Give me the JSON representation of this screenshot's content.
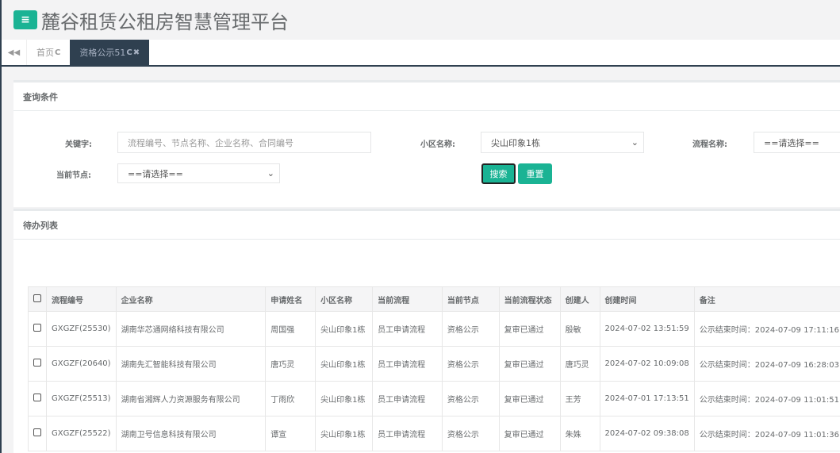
{
  "header": {
    "title": "麓谷租赁公租房智慧管理平台",
    "menu_icon": "≡"
  },
  "tabs": [
    {
      "label": "首页",
      "refresh": "C"
    },
    {
      "label": "资格公示51",
      "refresh": "C",
      "close": "✖"
    }
  ],
  "search_panel": {
    "title": "查询条件",
    "keyword_label": "关键字:",
    "keyword_placeholder": "流程编号、节点名称、企业名称、合同编号",
    "community_label": "小区名称:",
    "community_value": "尖山印象1栋",
    "process_label": "流程名称:",
    "process_value": "==请选择==",
    "node_label": "当前节点:",
    "node_value": "==请选择==",
    "search_button": "搜索",
    "reset_button": "重置"
  },
  "list_panel": {
    "title": "待办列表",
    "columns": [
      "流程编号",
      "企业名称",
      "申请姓名",
      "小区名称",
      "当前流程",
      "当前节点",
      "当前流程状态",
      "创建人",
      "创建时间",
      "备注"
    ],
    "rows": [
      [
        "GXGZF(25530)",
        "湖南华芯通网络科技有限公司",
        "周国强",
        "尖山印象1栋",
        "员工申请流程",
        "资格公示",
        "复审已通过",
        "殷敏",
        "2024-07-02 13:51:59",
        "公示结束时间：2024-07-09 17:11:16"
      ],
      [
        "GXGZF(20640)",
        "湖南先汇智能科技有限公司",
        "唐巧灵",
        "尖山印象1栋",
        "员工申请流程",
        "资格公示",
        "复审已通过",
        "唐巧灵",
        "2024-07-02 10:09:08",
        "公示结束时间：2024-07-09 16:28:03"
      ],
      [
        "GXGZF(25513)",
        "湖南省湘辉人力资源服务有限公司",
        "丁雨欣",
        "尖山印象1栋",
        "员工申请流程",
        "资格公示",
        "复审已通过",
        "王芳",
        "2024-07-01 17:13:51",
        "公示结束时间：2024-07-09 11:01:51"
      ],
      [
        "GXGZF(25522)",
        "湖南卫号信息科技有限公司",
        "谭宣",
        "尖山印象1栋",
        "员工申请流程",
        "资格公示",
        "复审已通过",
        "朱姝",
        "2024-07-02 09:38:08",
        "公示结束时间：2024-07-09 11:01:36"
      ]
    ]
  }
}
